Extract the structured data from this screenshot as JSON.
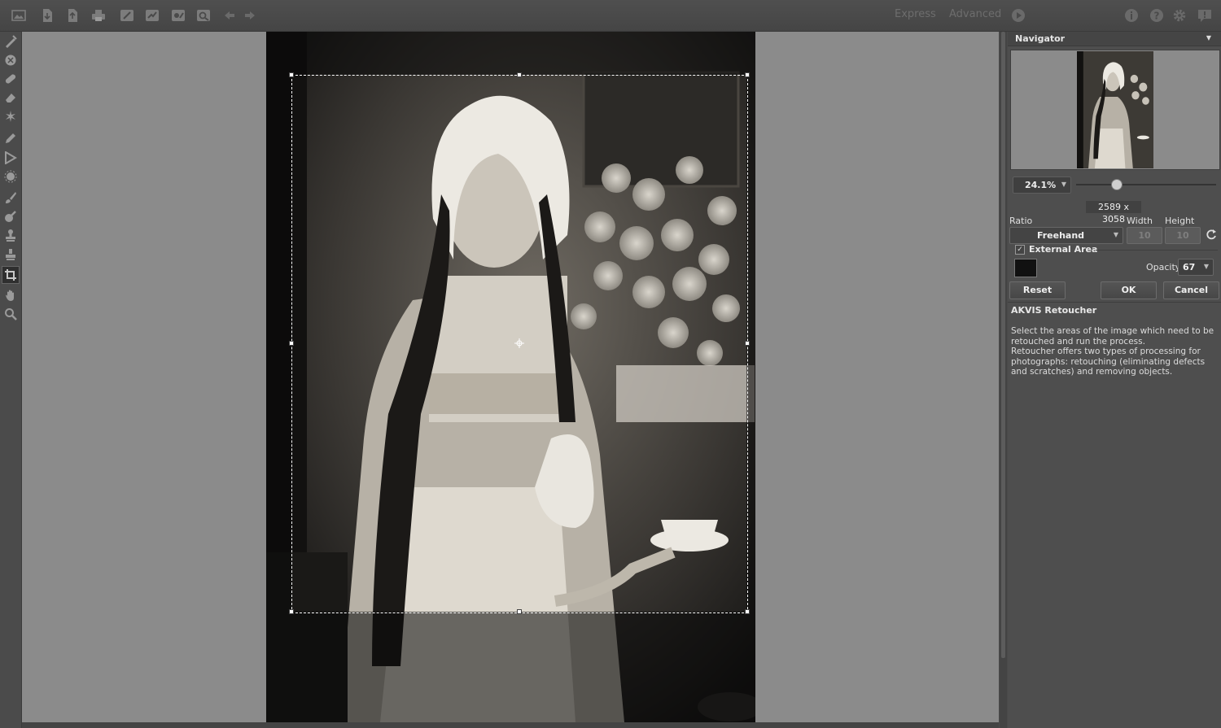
{
  "toolbar": {
    "buttons": [
      "home-icon",
      "open-icon",
      "save-icon",
      "print-icon",
      "brush-icon",
      "before-after-icon",
      "settings-preset-icon",
      "share-icon",
      "undo-icon",
      "redo-icon"
    ],
    "mode_express": "Express",
    "mode_advanced": "Advanced",
    "right_icons": [
      "info-icon",
      "help-icon",
      "gear-icon",
      "comment-icon"
    ]
  },
  "tools": [
    "retouch-brush",
    "patch-tool",
    "healing-brush",
    "eraser",
    "magic-wand",
    "pencil",
    "selection-arrow",
    "blur",
    "paint-brush",
    "smudge",
    "clone-stamp",
    "stamp-2",
    "crop",
    "hand",
    "zoom"
  ],
  "navigator": {
    "title": "Navigator",
    "zoom": "24.1%",
    "zoom_level": 0.24
  },
  "crop": {
    "image_size": "2589 x 3058",
    "ratio_label": "Ratio",
    "ratio_value": "Freehand",
    "width_label": "Width",
    "height_label": "Height",
    "width_value": "10",
    "height_value": "10",
    "external_area_label": "External Area",
    "external_area_checked": true,
    "external_color": "#111111",
    "opacity_label": "Opacity",
    "opacity_value": "67",
    "reset_label": "Reset",
    "ok_label": "OK",
    "cancel_label": "Cancel"
  },
  "help": {
    "title": "AKVIS Retoucher",
    "text": "Select the areas of the image which need to be retouched and run the process.\nRetoucher offers two types of processing for photographs: retouching (eliminating defects and scratches) and removing objects."
  }
}
